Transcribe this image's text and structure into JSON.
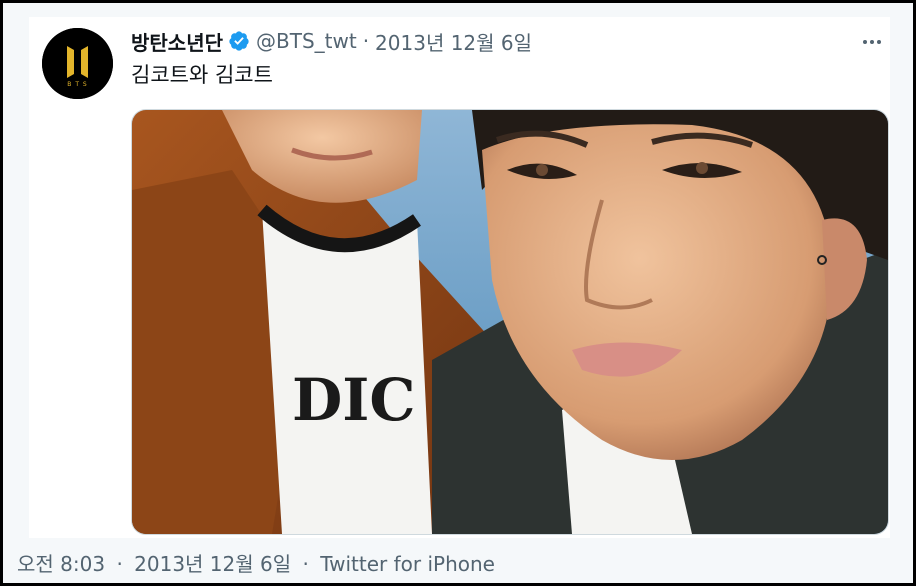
{
  "tweet": {
    "display_name": "방탄소년단",
    "handle": "@BTS_twt",
    "separator": "·",
    "date": "2013년 12월 6일",
    "text": "김코트와 김코트",
    "avatar_logo_text": "BTS"
  },
  "footer": {
    "time": "오전 8:03",
    "separator": "·",
    "date": "2013년 12월 6일",
    "source": "Twitter for iPhone"
  },
  "icons": {
    "verified": "verified-badge-icon",
    "more": "more-options-icon"
  },
  "colors": {
    "verified": "#1d9bf0",
    "secondary_text": "#536471",
    "logo_gold": "#c9a227"
  }
}
